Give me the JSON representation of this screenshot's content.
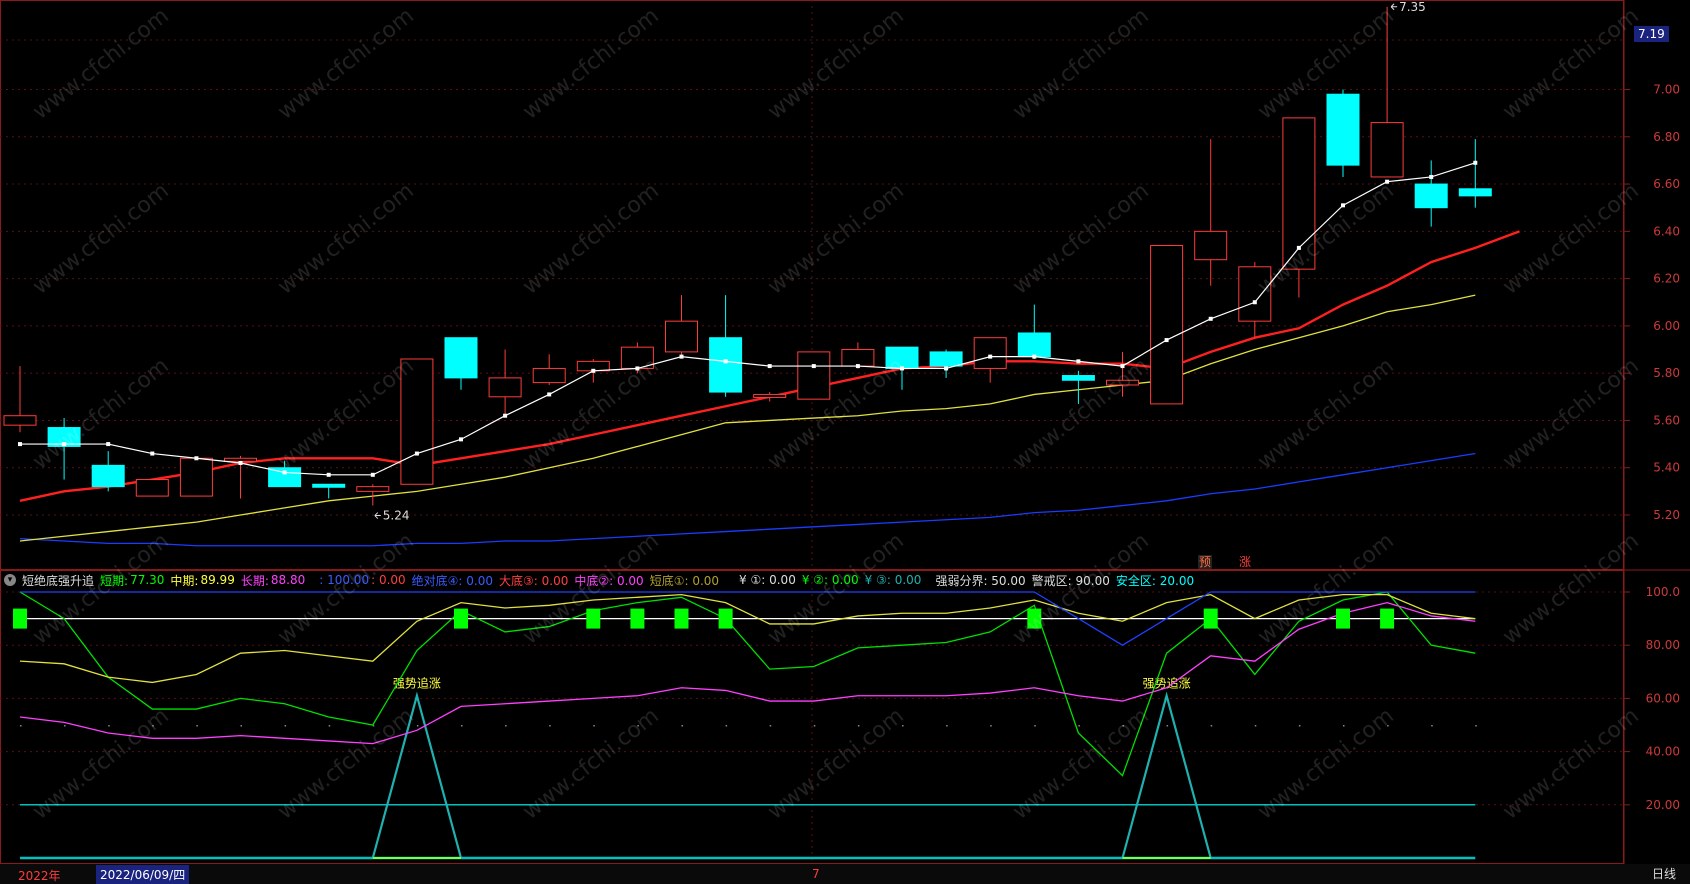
{
  "price_axis": {
    "ticks": [
      "7.00",
      "6.80",
      "6.60",
      "6.40",
      "6.20",
      "6.00",
      "5.80",
      "5.60",
      "5.40",
      "5.20"
    ],
    "last_price": "7.19"
  },
  "indicator_axis": {
    "ticks": [
      "100.0",
      "80.00",
      "60.00",
      "40.00",
      "20.00"
    ]
  },
  "legend": {
    "name": "短绝底强升追",
    "short_label": "短期:",
    "short_value": "77.30",
    "mid_label": "中期:",
    "mid_value": "89.99",
    "long_label": "长期:",
    "long_value": "88.80",
    "blank_value": ": 100.00",
    "blank2_value": ": 0.00",
    "abs_bottom": "绝对底④: 0.00",
    "big_bottom": "大底③: 0.00",
    "mid_bottom": "中底②: 0.00",
    "short_bottom": "短底①: 0.00",
    "y1": "¥ ①: 0.00",
    "y2": "¥ ②: 0.00",
    "y3": "¥ ③: 0.00",
    "strong_weak": "强弱分界: 50.00",
    "warn": "警戒区: 90.00",
    "safe": "安全区: 20.00"
  },
  "annotations": {
    "high": "7.35",
    "low": "5.24",
    "signal1": "强势追涨",
    "signal2": "强势追涨",
    "pre": "预",
    "rise": "涨"
  },
  "bottom": {
    "year": "2022年",
    "date": "2022/06/09/四",
    "month": "7",
    "period": "日线"
  },
  "colors": {
    "up": "#ff3b3b",
    "down": "#00ffff",
    "ma5": "#ffffff",
    "ma10": "#ff2020",
    "ma20": "#e0e040",
    "ma60": "#1a3cff"
  },
  "chart_data": [
    {
      "type": "candlestick",
      "title": "",
      "ylim": [
        5.1,
        7.4
      ],
      "candles": [
        {
          "o": 5.58,
          "h": 5.83,
          "l": 5.55,
          "c": 5.62
        },
        {
          "o": 5.57,
          "h": 5.61,
          "l": 5.35,
          "c": 5.49
        },
        {
          "o": 5.41,
          "h": 5.47,
          "l": 5.3,
          "c": 5.32
        },
        {
          "o": 5.28,
          "h": 5.35,
          "l": 5.28,
          "c": 5.35
        },
        {
          "o": 5.28,
          "h": 5.44,
          "l": 5.28,
          "c": 5.44
        },
        {
          "o": 5.44,
          "h": 5.45,
          "l": 5.27,
          "c": 5.44
        },
        {
          "o": 5.4,
          "h": 5.43,
          "l": 5.32,
          "c": 5.32
        },
        {
          "o": 5.33,
          "h": 5.33,
          "l": 5.27,
          "c": 5.32
        },
        {
          "o": 5.3,
          "h": 5.33,
          "l": 5.24,
          "c": 5.32
        },
        {
          "o": 5.33,
          "h": 5.86,
          "l": 5.33,
          "c": 5.86
        },
        {
          "o": 5.95,
          "h": 5.95,
          "l": 5.73,
          "c": 5.78
        },
        {
          "o": 5.7,
          "h": 5.9,
          "l": 5.62,
          "c": 5.78
        },
        {
          "o": 5.76,
          "h": 5.88,
          "l": 5.75,
          "c": 5.82
        },
        {
          "o": 5.81,
          "h": 5.86,
          "l": 5.76,
          "c": 5.85
        },
        {
          "o": 5.82,
          "h": 5.93,
          "l": 5.8,
          "c": 5.91
        },
        {
          "o": 5.89,
          "h": 6.13,
          "l": 5.87,
          "c": 6.02
        },
        {
          "o": 5.95,
          "h": 6.13,
          "l": 5.7,
          "c": 5.72
        },
        {
          "o": 5.7,
          "h": 5.72,
          "l": 5.68,
          "c": 5.71
        },
        {
          "o": 5.69,
          "h": 5.89,
          "l": 5.69,
          "c": 5.89
        },
        {
          "o": 5.83,
          "h": 5.93,
          "l": 5.82,
          "c": 5.9
        },
        {
          "o": 5.91,
          "h": 5.91,
          "l": 5.73,
          "c": 5.82
        },
        {
          "o": 5.89,
          "h": 5.9,
          "l": 5.78,
          "c": 5.83
        },
        {
          "o": 5.82,
          "h": 5.95,
          "l": 5.76,
          "c": 5.95
        },
        {
          "o": 5.97,
          "h": 6.09,
          "l": 5.86,
          "c": 5.87
        },
        {
          "o": 5.79,
          "h": 5.81,
          "l": 5.67,
          "c": 5.77
        },
        {
          "o": 5.75,
          "h": 5.89,
          "l": 5.7,
          "c": 5.77
        },
        {
          "o": 5.67,
          "h": 6.34,
          "l": 5.67,
          "c": 6.34
        },
        {
          "o": 6.28,
          "h": 6.79,
          "l": 6.17,
          "c": 6.4
        },
        {
          "o": 6.02,
          "h": 6.27,
          "l": 5.95,
          "c": 6.25
        },
        {
          "o": 6.24,
          "h": 6.88,
          "l": 6.12,
          "c": 6.88
        },
        {
          "o": 6.98,
          "h": 7.0,
          "l": 6.63,
          "c": 6.68
        },
        {
          "o": 6.63,
          "h": 7.35,
          "l": 6.63,
          "c": 6.86
        },
        {
          "o": 6.6,
          "h": 6.7,
          "l": 6.42,
          "c": 6.5
        },
        {
          "o": 6.58,
          "h": 6.79,
          "l": 6.5,
          "c": 6.55
        }
      ],
      "ma5": [
        5.5,
        5.5,
        5.5,
        5.46,
        5.44,
        5.42,
        5.38,
        5.37,
        5.37,
        5.46,
        5.52,
        5.62,
        5.71,
        5.81,
        5.82,
        5.87,
        5.85,
        5.83,
        5.83,
        5.83,
        5.82,
        5.82,
        5.87,
        5.87,
        5.85,
        5.83,
        5.94,
        6.03,
        6.1,
        6.33,
        6.51,
        6.61,
        6.63,
        6.69
      ],
      "ma10": [
        5.26,
        5.3,
        5.32,
        5.35,
        5.38,
        5.42,
        5.44,
        5.44,
        5.44,
        5.41,
        5.44,
        5.47,
        5.5,
        5.54,
        5.58,
        5.62,
        5.66,
        5.7,
        5.74,
        5.78,
        5.82,
        5.83,
        5.85,
        5.85,
        5.84,
        5.84,
        5.82,
        5.89,
        5.95,
        5.99,
        6.09,
        6.17,
        6.27,
        6.33,
        6.4
      ],
      "ma20": [
        5.09,
        5.11,
        5.13,
        5.15,
        5.17,
        5.2,
        5.23,
        5.26,
        5.28,
        5.3,
        5.33,
        5.36,
        5.4,
        5.44,
        5.49,
        5.54,
        5.59,
        5.6,
        5.61,
        5.62,
        5.64,
        5.65,
        5.67,
        5.71,
        5.73,
        5.75,
        5.77,
        5.84,
        5.9,
        5.95,
        6.0,
        6.06,
        6.09,
        6.13
      ],
      "ma60": [
        5.1,
        5.09,
        5.08,
        5.08,
        5.07,
        5.07,
        5.07,
        5.07,
        5.07,
        5.08,
        5.08,
        5.09,
        5.09,
        5.1,
        5.11,
        5.12,
        5.13,
        5.14,
        5.15,
        5.16,
        5.17,
        5.18,
        5.19,
        5.21,
        5.22,
        5.24,
        5.26,
        5.29,
        5.31,
        5.34,
        5.37,
        5.4,
        5.43,
        5.46
      ]
    },
    {
      "type": "line",
      "title": "短绝底强升追",
      "ylim": [
        0,
        102
      ],
      "series": [
        {
          "name": "短期",
          "values": [
            100,
            90,
            68,
            56,
            56,
            60,
            58,
            53,
            50,
            78,
            93,
            85,
            87,
            93,
            96,
            98,
            90,
            71,
            72,
            79,
            80,
            81,
            85,
            95,
            47,
            31,
            77,
            90,
            69,
            89,
            97,
            100,
            80,
            77
          ]
        },
        {
          "name": "中期",
          "values": [
            74,
            73,
            68,
            66,
            69,
            77,
            78,
            76,
            74,
            89,
            96,
            94,
            95,
            97,
            98,
            99,
            96,
            88,
            88,
            91,
            92,
            92,
            94,
            97,
            92,
            89,
            96,
            99,
            90,
            97,
            99,
            99,
            92,
            90
          ]
        },
        {
          "name": "长期",
          "values": [
            53,
            51,
            47,
            45,
            45,
            46,
            45,
            44,
            43,
            48,
            57,
            58,
            59,
            60,
            61,
            64,
            63,
            59,
            59,
            61,
            61,
            61,
            62,
            64,
            61,
            59,
            64,
            76,
            74,
            86,
            92,
            96,
            91,
            89
          ]
        },
        {
          "name": "",
          "values": [
            100,
            100,
            100,
            100,
            100,
            100,
            100,
            100,
            100,
            100,
            100,
            100,
            100,
            100,
            100,
            100,
            100,
            100,
            100,
            100,
            100,
            100,
            100,
            100,
            90,
            80,
            90,
            100,
            100,
            100,
            100,
            100,
            100,
            100
          ]
        }
      ],
      "reference_lines": [
        90,
        20,
        50
      ],
      "signal_bars": [
        0,
        10,
        13,
        14,
        15,
        16,
        23,
        27,
        30,
        31
      ],
      "spikes": [
        {
          "from": 8,
          "peak": 9,
          "to": 10,
          "value": 61,
          "label": "强势追涨"
        },
        {
          "from": 25,
          "peak": 26,
          "to": 27,
          "value": 61,
          "label": "强势追涨"
        }
      ]
    }
  ]
}
